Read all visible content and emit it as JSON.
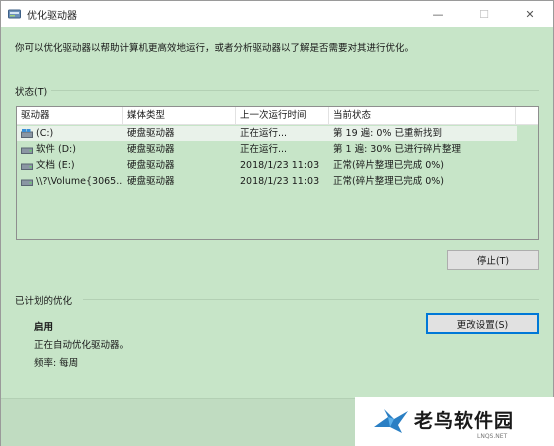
{
  "window": {
    "title": "优化驱动器",
    "controls": {
      "minimize": "—",
      "maximize": "☐",
      "close": "✕"
    }
  },
  "description": "你可以优化驱动器以帮助计算机更高效地运行，或者分析驱动器以了解是否需要对其进行优化。",
  "status_section": {
    "label": "状态(T)",
    "columns": [
      "驱动器",
      "媒体类型",
      "上一次运行时间",
      "当前状态"
    ],
    "rows": [
      {
        "drive": "(C:)",
        "media": "硬盘驱动器",
        "last_run": "正在运行...",
        "status": "第 19 遍: 0% 已重新找到",
        "icon": "windows-drive-icon",
        "selected": true
      },
      {
        "drive": "软件 (D:)",
        "media": "硬盘驱动器",
        "last_run": "正在运行...",
        "status": "第 1 遍: 30% 已进行碎片整理",
        "icon": "hard-drive-icon",
        "selected": false
      },
      {
        "drive": "文档 (E:)",
        "media": "硬盘驱动器",
        "last_run": "2018/1/23 11:03",
        "status": "正常(碎片整理已完成 0%)",
        "icon": "hard-drive-icon",
        "selected": false
      },
      {
        "drive": "\\\\?\\Volume{3065...",
        "media": "硬盘驱动器",
        "last_run": "2018/1/23 11:03",
        "status": "正常(碎片整理已完成 0%)",
        "icon": "hard-drive-icon",
        "selected": false
      }
    ],
    "stop_button": "停止(T)"
  },
  "scheduled_section": {
    "label": "已计划的优化",
    "state": "启用",
    "info": "正在自动优化驱动器。",
    "frequency": "频率: 每周",
    "change_button": "更改设置(S)"
  },
  "watermark": {
    "text": "老鸟软件园",
    "sub": "LNQS.NET"
  },
  "colors": {
    "background": "#c7e5c8",
    "accent": "#0078d7"
  }
}
